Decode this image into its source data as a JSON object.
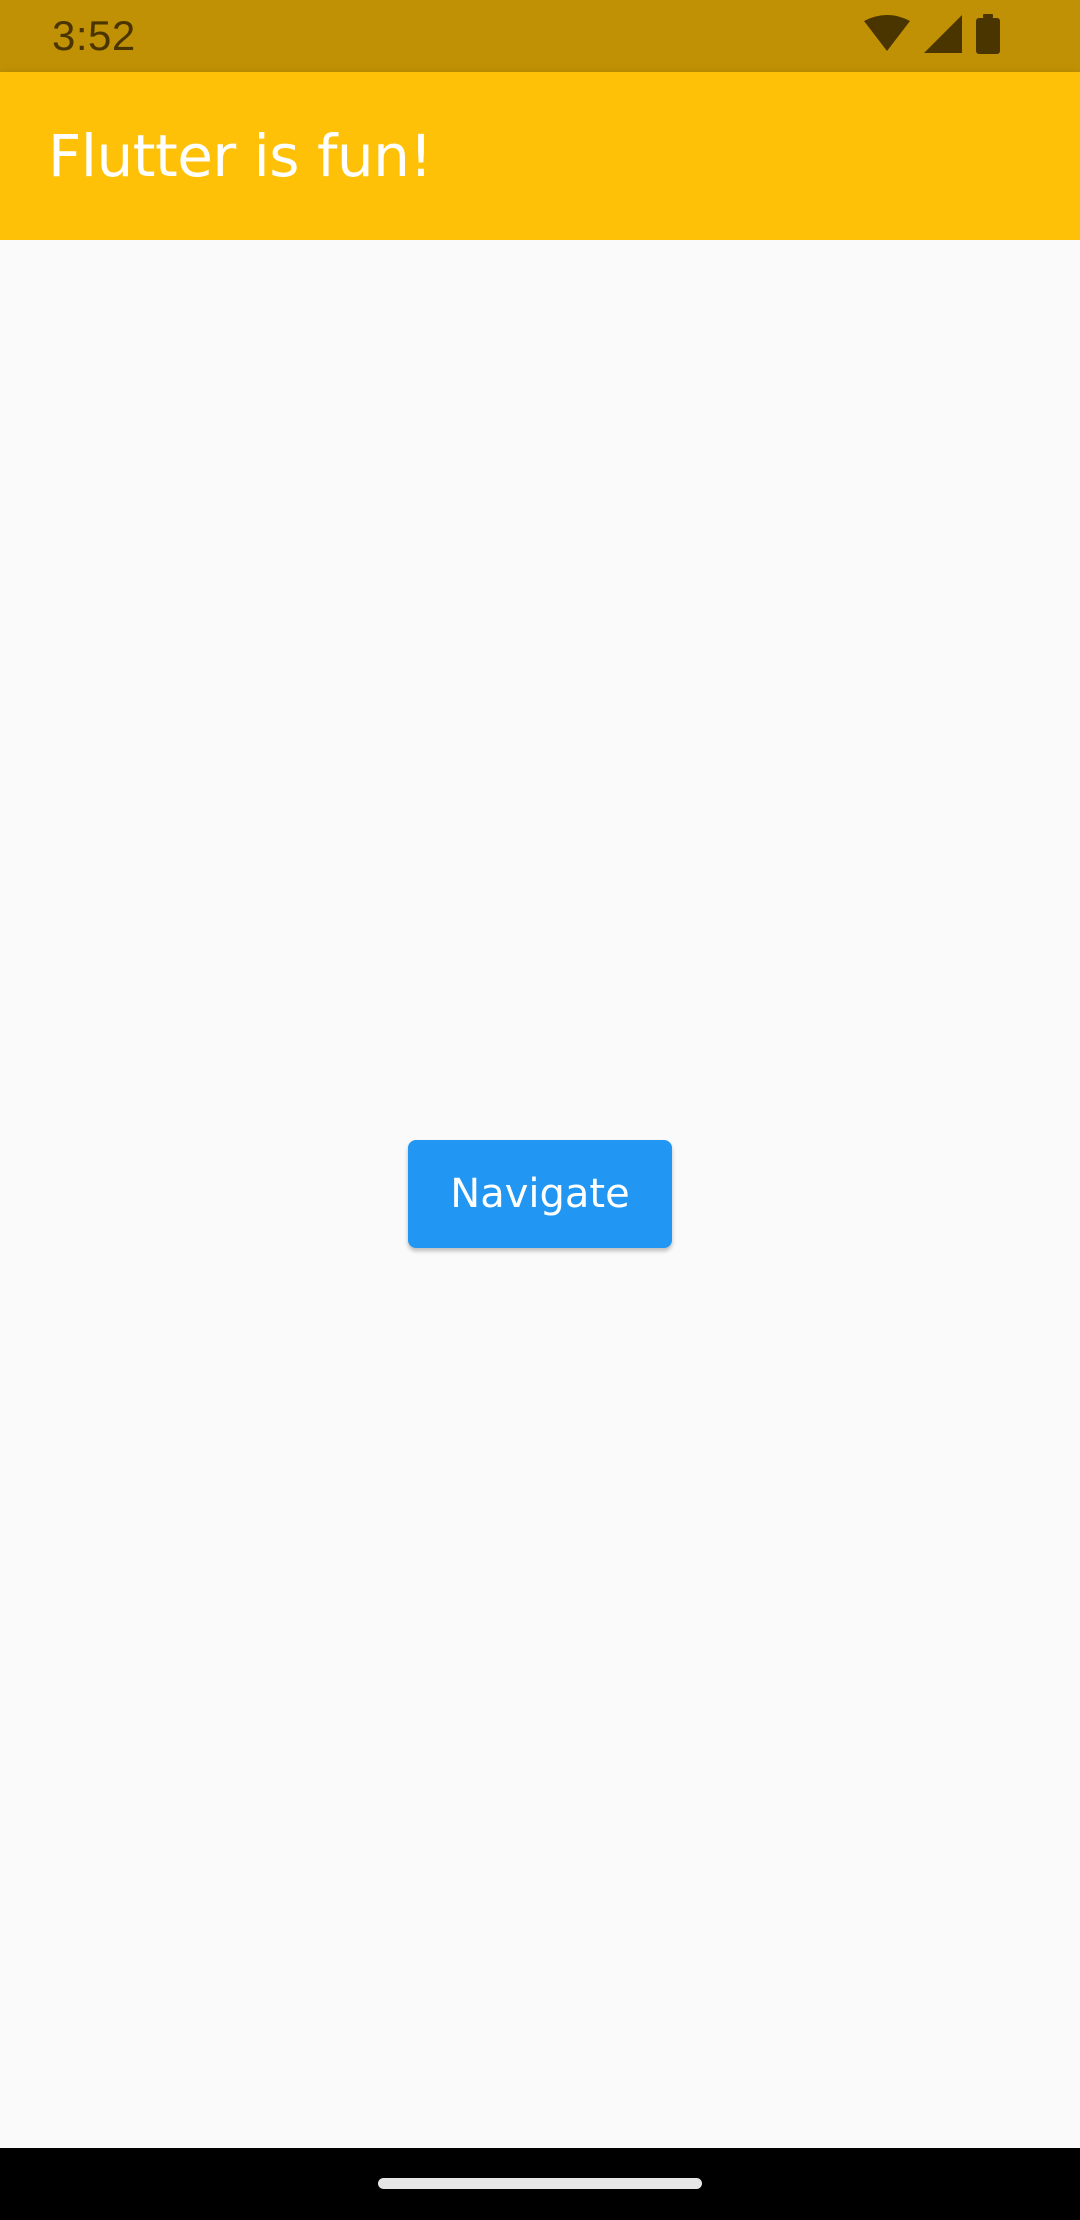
{
  "status_bar": {
    "time": "3:52",
    "icons": [
      "wifi-icon",
      "signal-icon",
      "battery-icon"
    ]
  },
  "app_bar": {
    "title": "Flutter is fun!"
  },
  "main": {
    "navigate_button_label": "Navigate"
  },
  "colors": {
    "status_bar": "#c09104",
    "app_bar": "#ffc107",
    "background": "#fafafa",
    "button": "#2196f3",
    "nav_bar": "#000000"
  }
}
